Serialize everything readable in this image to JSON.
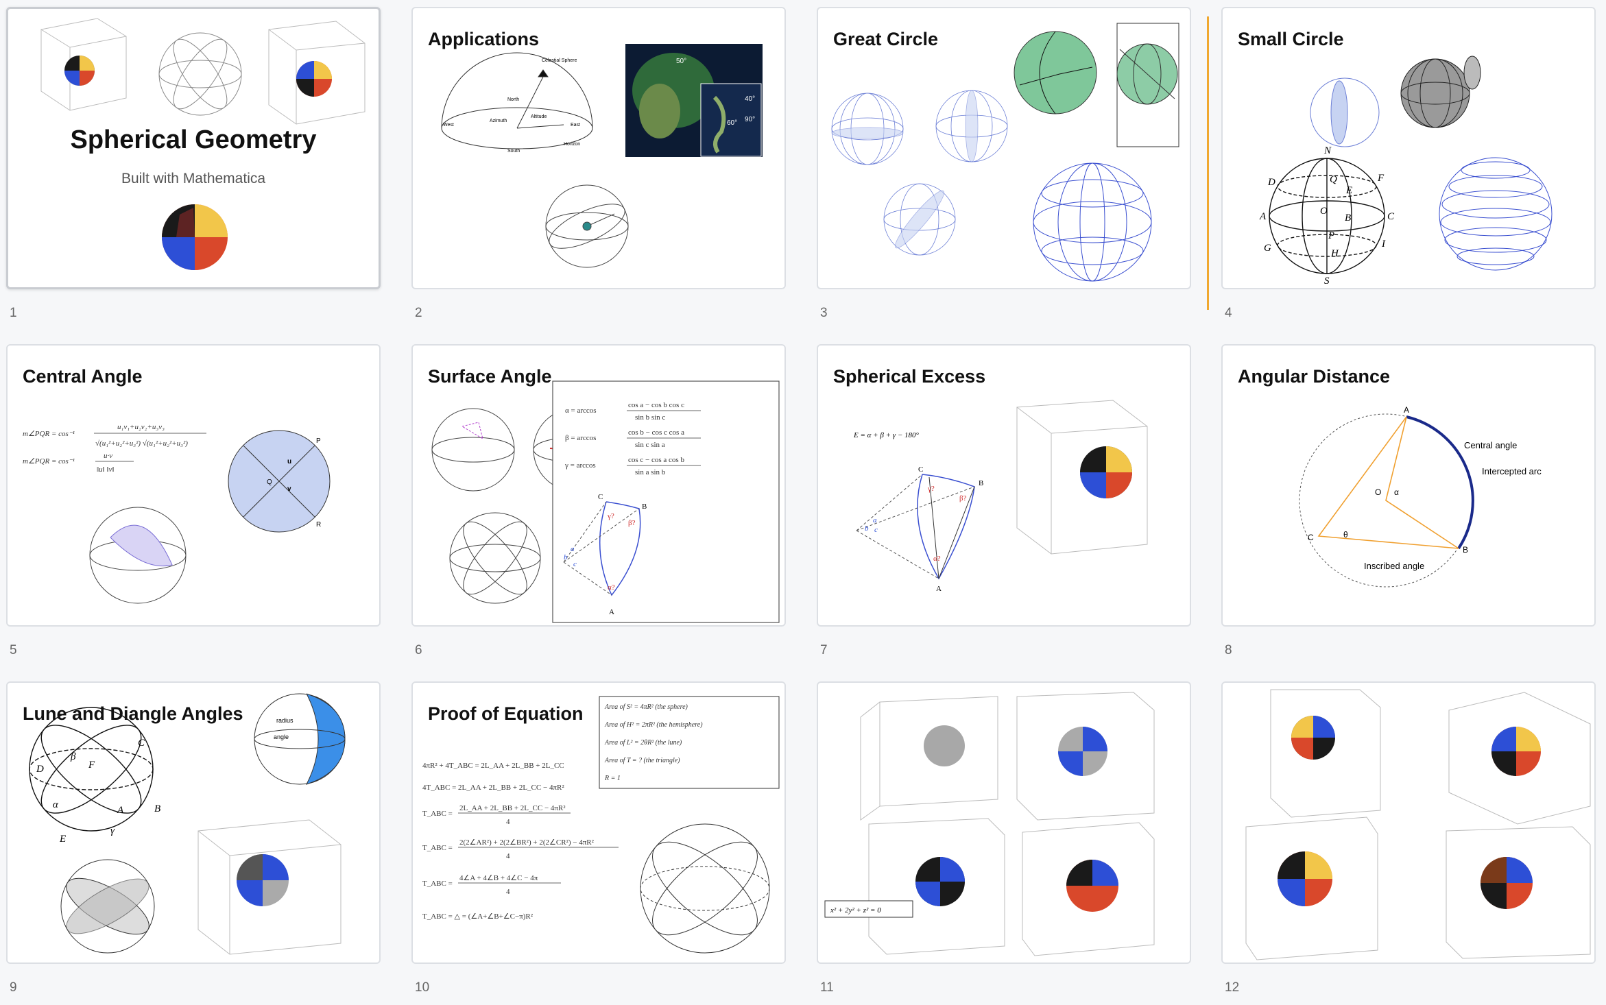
{
  "slides": [
    {
      "number": "1",
      "title": "Spherical Geometry",
      "subtitle": "Built with Mathematica"
    },
    {
      "number": "2",
      "title": "Applications"
    },
    {
      "number": "3",
      "title": "Great Circle"
    },
    {
      "number": "4",
      "title": "Small Circle"
    },
    {
      "number": "5",
      "title": "Central Angle"
    },
    {
      "number": "6",
      "title": "Surface Angle"
    },
    {
      "number": "7",
      "title": "Spherical Excess"
    },
    {
      "number": "8",
      "title": "Angular Distance"
    },
    {
      "number": "9",
      "title": "Lune and Diangle Angles"
    },
    {
      "number": "10",
      "title": "Proof of Equation"
    },
    {
      "number": "11",
      "title": ""
    },
    {
      "number": "12",
      "title": ""
    }
  ],
  "figure_text": {
    "s2": {
      "celestial": "Celestial Sphere",
      "north": "North",
      "west": "West",
      "east": "East",
      "south": "South",
      "horizon": "Horizon",
      "azimuth": "Azimuth",
      "altitude": "Altitude",
      "lat1": "50°",
      "lat2": "40°",
      "lat3": "60°",
      "lat4": "90°"
    },
    "s4": {
      "N": "N",
      "D": "D",
      "F": "F",
      "A": "A",
      "C": "C",
      "G": "G",
      "I": "I",
      "S": "S",
      "Q": "Q",
      "E": "E",
      "O": "O",
      "B": "B",
      "P": "P",
      "H": "H"
    },
    "s5": {
      "f1a": "m∠PQR = cos⁻¹",
      "f1b": "u₁v₁+u₂v₂+u₃v₃",
      "f1c": "√(u₁²+u₂²+u₃²) √(u₁²+u₂²+u₃²)",
      "f2a": "m∠PQR = cos⁻¹",
      "f2b": "u·v",
      "f2c": "‖u‖ ‖v‖",
      "P": "P",
      "Q": "Q",
      "R": "R",
      "u": "u",
      "v": "v"
    },
    "s6": {
      "alpha": "α = arccos",
      "alpha_num": "cos a − cos b cos c",
      "alpha_den": "sin b sin c",
      "beta": "β = arccos",
      "beta_num": "cos b − cos c cos a",
      "beta_den": "sin c sin a",
      "gamma": "γ = arccos",
      "gamma_num": "cos c − cos a cos b",
      "gamma_den": "sin a sin b",
      "A": "A",
      "B": "B",
      "C": "C",
      "ga": "γ?",
      "be": "β?",
      "al": "α?",
      "b": "b",
      "c": "c",
      "a": "a"
    },
    "s7": {
      "formula": "E = α + β + γ − 180°",
      "A": "A",
      "B": "B",
      "C": "C",
      "ga": "γ?",
      "be": "β?",
      "al": "α?",
      "b": "b",
      "c": "c",
      "a": "a"
    },
    "s8": {
      "central": "Central angle",
      "intercepted": "Intercepted arc",
      "inscribed": "Inscribed angle",
      "A": "A",
      "B": "B",
      "C": "C",
      "O": "O",
      "alpha": "α",
      "theta": "θ"
    },
    "s9": {
      "C": "C",
      "D": "D",
      "F": "F",
      "A": "A",
      "B": "B",
      "E": "E",
      "beta": "β",
      "alpha": "α",
      "gamma": "γ",
      "radius": "radius",
      "angle": "angle"
    },
    "s10": {
      "area1": "Area of S² = 4πR² (the sphere)",
      "area2": "Area of H² = 2πR² (the hemisphere)",
      "area3": "Area of L² = 2θR² (the lune)",
      "area4": "Area of T = ? (the triangle)",
      "area5": "R = 1",
      "eq1": "4πR² + 4T_ABC = 2L_AA + 2L_BB + 2L_CC",
      "eq2": "4T_ABC = 2L_AA + 2L_BB + 2L_CC − 4πR²",
      "eq3a": "T_ABC =",
      "eq3b": "2L_AA + 2L_BB + 2L_CC − 4πR²",
      "eq4b": "2(2∠AR²) + 2(2∠BR²) + 2(2∠CR²) − 4πR²",
      "eq5b": "4∠A + 4∠B + 4∠C − 4π",
      "den": "4",
      "eq6": "T_ABC = △ = (∠A+∠B+∠C−π)R²"
    },
    "s11": {
      "equation": "x² + 2y² + z² = 0"
    }
  },
  "colors": {
    "accent_marker": "#f0a830",
    "sphere_blue": "#2d4fd6",
    "sphere_red": "#d9482b",
    "sphere_yellow": "#f2c64a",
    "sphere_black": "#1a1a1a",
    "sphere_green": "#7fc79a",
    "fill_blue": "#c7d3f2",
    "wire_blue": "#3a4fd0"
  }
}
